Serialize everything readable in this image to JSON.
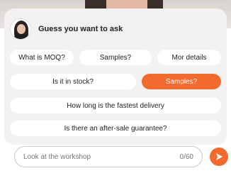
{
  "header": {
    "title": "Guess you want to ask"
  },
  "suggestions": [
    {
      "label": "What is MOQ?",
      "active": false
    },
    {
      "label": "Samples?",
      "active": false
    },
    {
      "label": "Mor details",
      "active": false
    },
    {
      "label": "Is it in stock?",
      "active": false
    },
    {
      "label": "Samples?",
      "active": true
    },
    {
      "label": "How long is the fastest delivery",
      "active": false
    },
    {
      "label": "Is there an after-sale guarantee?",
      "active": false
    }
  ],
  "composer": {
    "placeholder": "Look at the workshop",
    "counter": "0/60"
  },
  "colors": {
    "accent": "#f26a2e",
    "card": "#f3f1f1"
  },
  "icons": {
    "send": "send-arrow-icon",
    "avatar": "agent-avatar"
  }
}
